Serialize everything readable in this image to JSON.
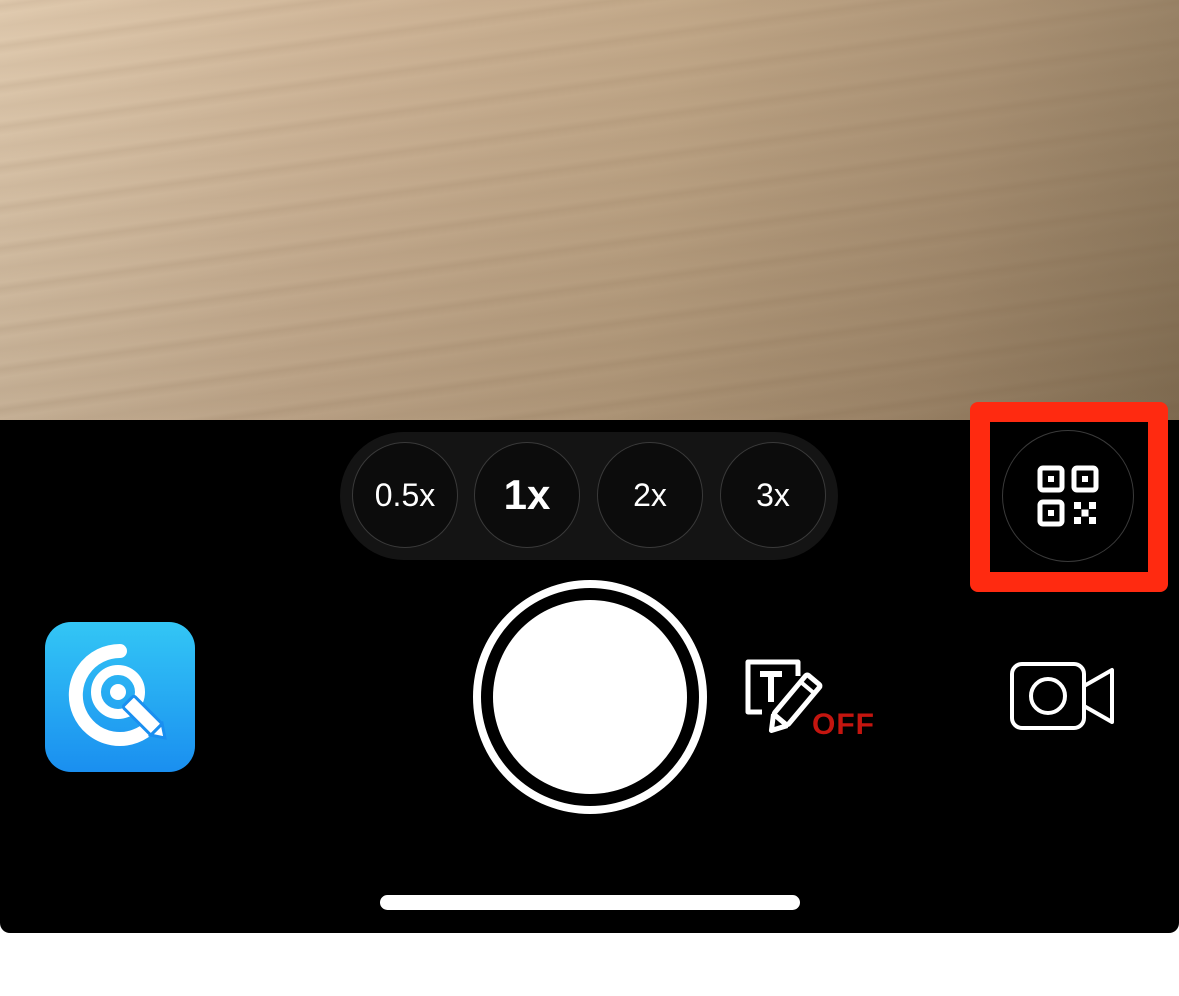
{
  "camera": {
    "zoom_options": [
      {
        "label": "0.5x",
        "active": false
      },
      {
        "label": "1x",
        "active": true
      },
      {
        "label": "2x",
        "active": false
      },
      {
        "label": "3x",
        "active": false
      }
    ],
    "text_recognition": {
      "icon": "text-edit-icon",
      "status": "OFF"
    },
    "qr_scanner": {
      "icon": "qr-code-icon",
      "highlighted": true
    },
    "video_mode": {
      "icon": "video-camera-icon"
    },
    "app_icon": {
      "icon": "camera-pen-icon"
    },
    "shutter": {
      "icon": "shutter"
    }
  },
  "colors": {
    "highlight": "#ff2a10",
    "off_status": "#c4150f",
    "app_icon_top": "#33c6f5",
    "app_icon_bottom": "#1a8ff0"
  }
}
